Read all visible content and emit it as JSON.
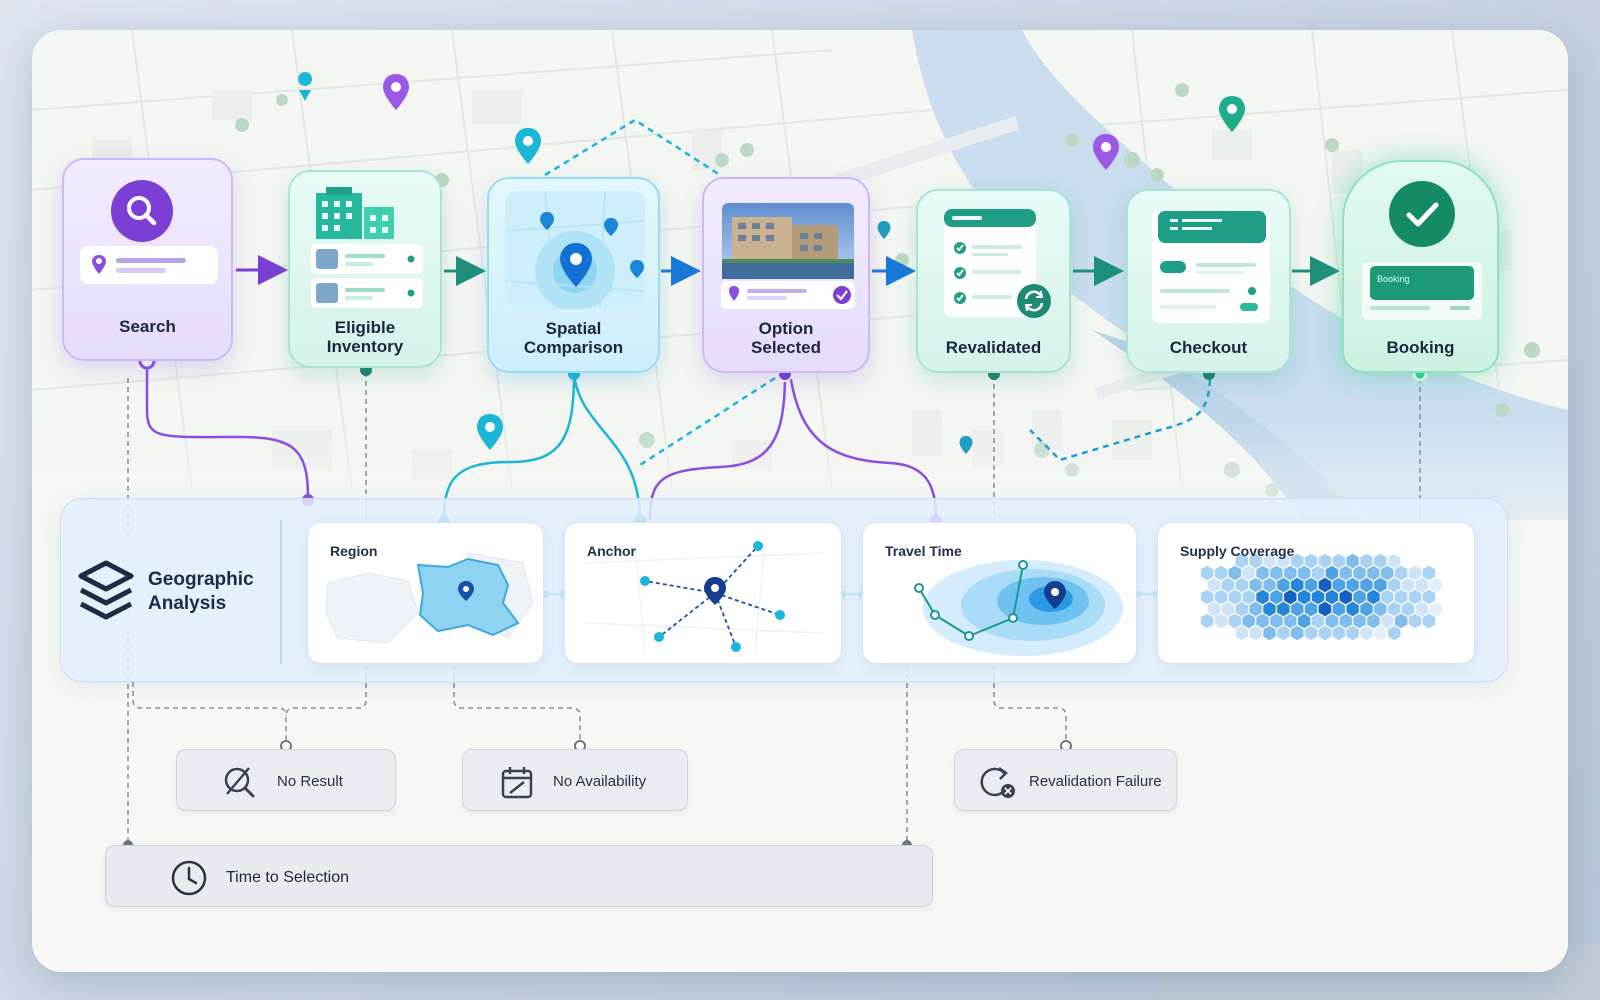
{
  "stages": [
    {
      "id": "search",
      "label": "Search"
    },
    {
      "id": "eligible-inventory",
      "label": "Eligible\nInventory"
    },
    {
      "id": "spatial-comparison",
      "label": "Spatial\nComparison"
    },
    {
      "id": "option-selected",
      "label": "Option\nSelected"
    },
    {
      "id": "revalidated",
      "label": "Revalidated"
    },
    {
      "id": "checkout",
      "label": "Checkout"
    },
    {
      "id": "booking",
      "label": "Booking"
    }
  ],
  "geographic_analysis": {
    "title": "Geographic\nAnalysis",
    "cards": [
      {
        "id": "region",
        "label": "Region"
      },
      {
        "id": "anchor",
        "label": "Anchor"
      },
      {
        "id": "travel-time",
        "label": "Travel Time"
      },
      {
        "id": "supply-coverage",
        "label": "Supply Coverage"
      }
    ]
  },
  "failures": [
    {
      "id": "no-result",
      "label": "No Result"
    },
    {
      "id": "no-availability",
      "label": "No Availability"
    },
    {
      "id": "revalidation-failure",
      "label": "Revalidation Failure"
    }
  ],
  "time_bar": {
    "label": "Time to Selection",
    "markers": 3
  },
  "booking_tag": "Booking",
  "colors": {
    "purple": "#7b3fd6",
    "teal": "#1f9e86",
    "cyan": "#1bb6d8",
    "blue": "#1a6fd8",
    "green": "#159a6c"
  },
  "icons": [
    "search-icon",
    "location-pin-icon",
    "building-icon",
    "check-icon",
    "refresh-icon",
    "layers-icon",
    "no-result-icon",
    "calendar-icon",
    "revalidation-failure-icon",
    "clock-icon"
  ]
}
